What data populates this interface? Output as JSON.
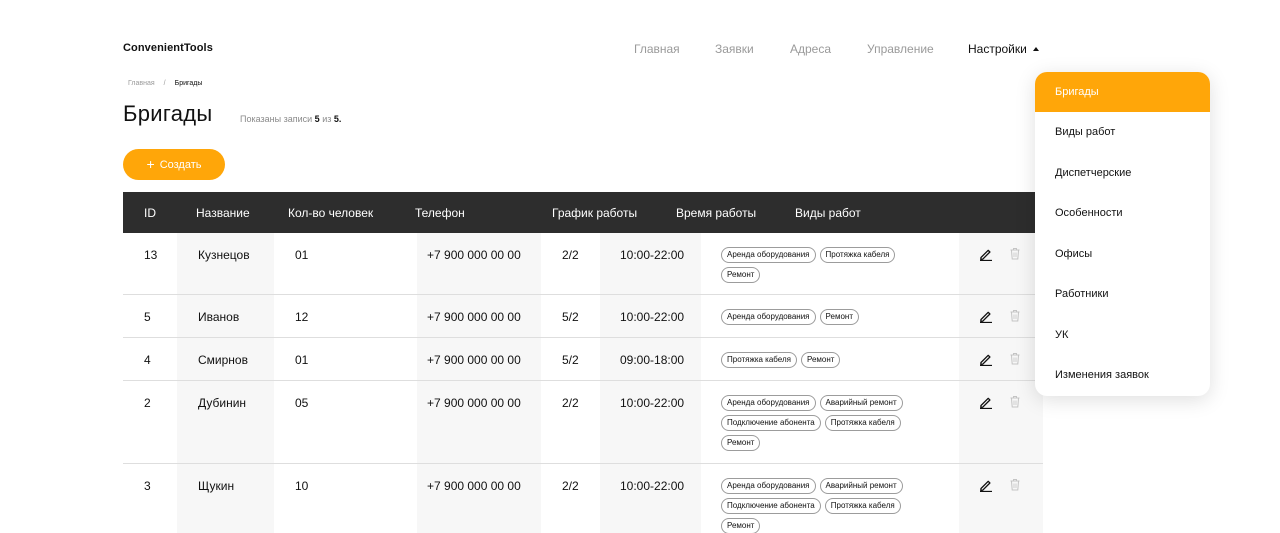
{
  "brand": "ConvenientTools",
  "nav": {
    "items": [
      "Главная",
      "Заявки",
      "Адреса",
      "Управление"
    ],
    "settings_label": "Настройки"
  },
  "breadcrumb": {
    "home": "Главная",
    "separator": "/",
    "current": "Бригады"
  },
  "page": {
    "title": "Бригады",
    "records_prefix": "Показаны записи",
    "records_shown": "5",
    "records_of": "из",
    "records_total": "5."
  },
  "create_button": {
    "plus": "+",
    "label": "Создать"
  },
  "table": {
    "headers": [
      "ID",
      "Название",
      "Кол-во человек",
      "Телефон",
      "График работы",
      "Время работы",
      "Виды работ"
    ],
    "rows": [
      {
        "id": "13",
        "name": "Кузнецов",
        "people": "01",
        "phone": "+7 900 000 00 00",
        "schedule": "2/2",
        "time": "10:00-22:00",
        "tags": [
          "Аренда оборудования",
          "Протяжка кабеля",
          "Ремонт"
        ]
      },
      {
        "id": "5",
        "name": "Иванов",
        "people": "12",
        "phone": "+7 900 000 00 00",
        "schedule": "5/2",
        "time": "10:00-22:00",
        "tags": [
          "Аренда оборудования",
          "Ремонт"
        ]
      },
      {
        "id": "4",
        "name": "Смирнов",
        "people": "01",
        "phone": "+7 900 000 00 00",
        "schedule": "5/2",
        "time": "09:00-18:00",
        "tags": [
          "Протяжка кабеля",
          "Ремонт"
        ]
      },
      {
        "id": "2",
        "name": "Дубинин",
        "people": "05",
        "phone": "+7 900 000 00 00",
        "schedule": "2/2",
        "time": "10:00-22:00",
        "tags": [
          "Аренда оборудования",
          "Аварийный ремонт",
          "Подключение абонента",
          "Протяжка кабеля",
          "Ремонт"
        ]
      },
      {
        "id": "3",
        "name": "Щукин",
        "people": "10",
        "phone": "+7 900 000 00 00",
        "schedule": "2/2",
        "time": "10:00-22:00",
        "tags": [
          "Аренда оборудования",
          "Аварийный ремонт",
          "Подключение абонента",
          "Протяжка кабеля",
          "Ремонт"
        ]
      }
    ],
    "actions": {
      "edit_icon": "pencil-icon",
      "delete_icon": "trash-icon"
    }
  },
  "settings_menu": {
    "items": [
      "Бригады",
      "Виды работ",
      "Диспетчерские",
      "Особенности",
      "Офисы",
      "Работники",
      "УК",
      "Изменения заявок"
    ],
    "active": "Бригады"
  },
  "colors": {
    "accent": "#ffa609",
    "header_bg": "#2d2d2d",
    "muted_text": "#9a9a9a",
    "column_shade": "#f7f7f7"
  }
}
